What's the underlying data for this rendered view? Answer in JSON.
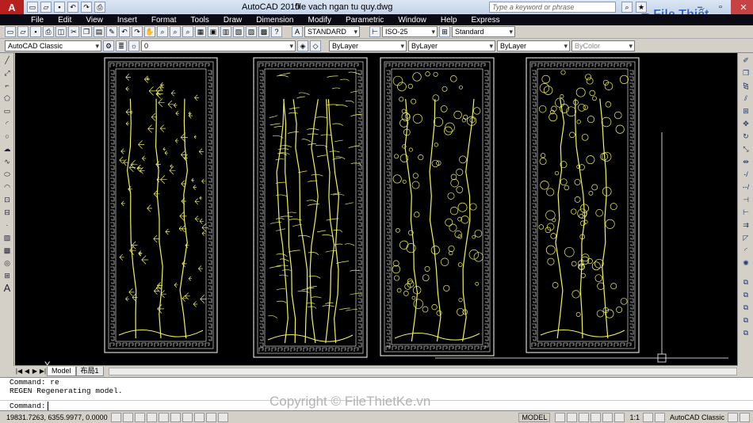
{
  "app": {
    "name": "AutoCAD 2010",
    "file": "file vach ngan tu quy.dwg",
    "search_placeholder": "Type a keyword or phrase",
    "brand_logo": "File Thiết Kế.vn"
  },
  "menu": [
    "File",
    "Edit",
    "View",
    "Insert",
    "Format",
    "Tools",
    "Draw",
    "Dimension",
    "Modify",
    "Parametric",
    "Window",
    "Help",
    "Express"
  ],
  "toolbar": {
    "text_style": "STANDARD",
    "dim_style": "ISO-25",
    "table_style": "Standard",
    "workspace": "AutoCAD Classic",
    "layer": "0",
    "color": "ByLayer",
    "linetype": "ByLayer",
    "lineweight": "ByLayer",
    "plotstyle": "ByColor"
  },
  "tabs": [
    "Model",
    "布局1"
  ],
  "command": {
    "history": [
      "Command: re",
      "REGEN Regenerating model."
    ],
    "prompt": "Command:"
  },
  "watermark": "Copyright © FileThietKe.vn",
  "status": {
    "coords": "19831.7263, 6355.9977, 0.0000",
    "model_label": "MODEL",
    "scale": "1:1",
    "workspace": "AutoCAD Classic"
  },
  "ucs": {
    "x_label": "X",
    "y_label": "Y"
  },
  "colors": {
    "drawing": "#f2f25a",
    "frame": "#ffffff",
    "canvas": "#000000",
    "menu_bg": "#0a0a14"
  },
  "panels": [
    {
      "name": "pine-crane-panel",
      "motif": "pine"
    },
    {
      "name": "bamboo-panel",
      "motif": "bamboo"
    },
    {
      "name": "chrysanthemum-panel",
      "motif": "chrysanthemum"
    },
    {
      "name": "apricot-blossom-panel",
      "motif": "apricot"
    }
  ]
}
